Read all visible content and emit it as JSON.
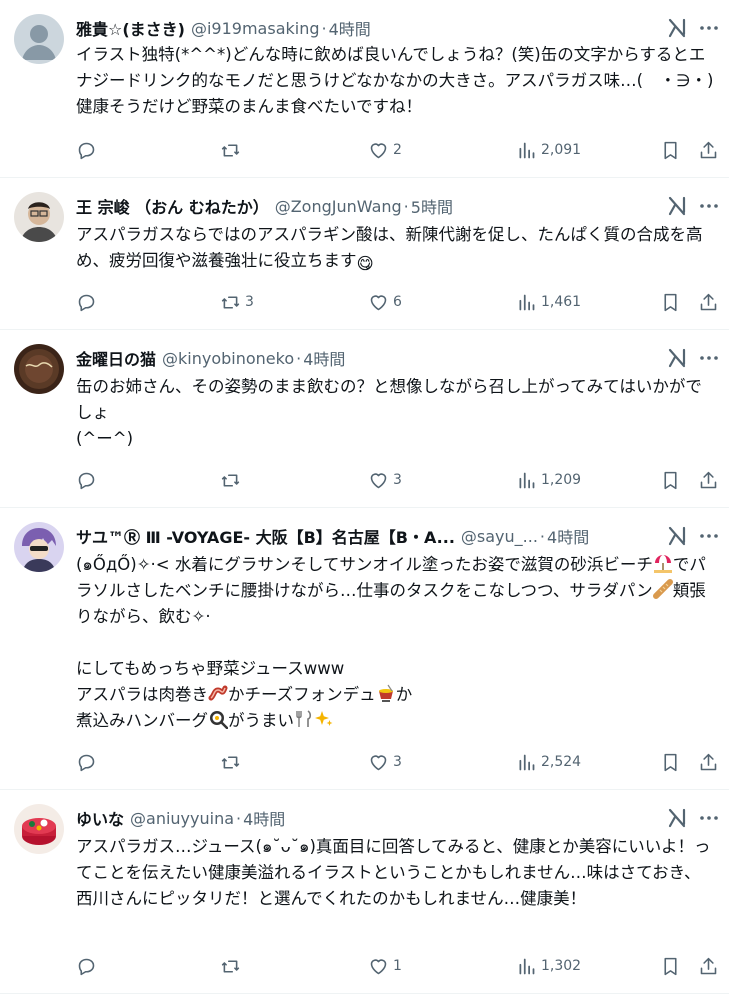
{
  "posts": [
    {
      "name": "雅貴☆(まさき)",
      "handle": "@i919masaking",
      "dot": "·",
      "time": "4時間",
      "text": "イラスト独特(*^^*)どんな時に飲めば良いんでしょうね？(笑)缶の文字からするとエナジードリンク的なモノだと思うけどなかなかの大きさ。アスパラガス味…(　・∋・)健康そうだけど野菜のまんま食べたいですね！",
      "replies": "",
      "reposts": "",
      "likes": "2",
      "views": "2,091"
    },
    {
      "name": "王 宗峻 （おん むねたか）",
      "handle": "@ZongJunWang",
      "dot": "·",
      "time": "5時間",
      "text": "アスパラガスならではのアスパラギン酸は、新陳代謝を促し、たんぱく質の合成を高め、疲労回復や滋養強壮に役立ちます",
      "emoji_after": "😋",
      "replies": "",
      "reposts": "3",
      "likes": "6",
      "views": "1,461"
    },
    {
      "name": "金曜日の猫",
      "handle": "@kinyobinoneko",
      "dot": "·",
      "time": "4時間",
      "text": "缶のお姉さん、その姿勢のまま飲むの？と想像しながら召し上がってみてはいかがでしょ\n(^ー^)",
      "replies": "",
      "reposts": "",
      "likes": "3",
      "views": "1,209"
    },
    {
      "name": "サユ™Ⓡ Ⅲ -VOYAGE- 大阪【B】名古屋【B・A...",
      "handle": "@sayu_...",
      "dot": "·",
      "time": "4時間",
      "text_parts": [
        "(๑ŐдŐ)✧‧< 水着にグラサンそしてサンオイル塗ったお姿で滋賀の砂浜ビーチ",
        "でパラソルさしたベンチに腰掛けながら…仕事のタスクをこなしつつ、サラダパン",
        "頬張りながら、飲む✧‧\n\nにしてもめっちゃ野菜ジュースwww\nアスパラは肉巻き",
        "かチーズフォンデュ",
        "か\n煮込みハンバーグ",
        "がうまい",
        ""
      ],
      "replies": "",
      "reposts": "",
      "likes": "3",
      "views": "2,524"
    },
    {
      "name": "ゆいな",
      "handle": "@aniuyyuina",
      "dot": "·",
      "time": "4時間",
      "text": "アスパラガス…ジュース(๑˘ᴗ˘๑)真面目に回答してみると、健康とか美容にいいよ！ってことを伝えたい健康美溢れるイラストということかもしれません…味はさておき、西川さんにピッタリだ！と選んでくれたのかもしれません…健康美！",
      "replies": "",
      "reposts": "",
      "likes": "1",
      "views": "1,302"
    }
  ],
  "icons": {
    "avatar": "default-avatar-icon",
    "grok": "grok-icon",
    "more": "more-icon",
    "reply": "reply-icon",
    "repost": "repost-icon",
    "like": "heart-icon",
    "views": "views-chart-icon",
    "bookmark": "bookmark-icon",
    "share": "share-icon"
  },
  "colors": {
    "text": "#0f1419",
    "secondary": "#536471",
    "divider": "#eff3f4"
  }
}
